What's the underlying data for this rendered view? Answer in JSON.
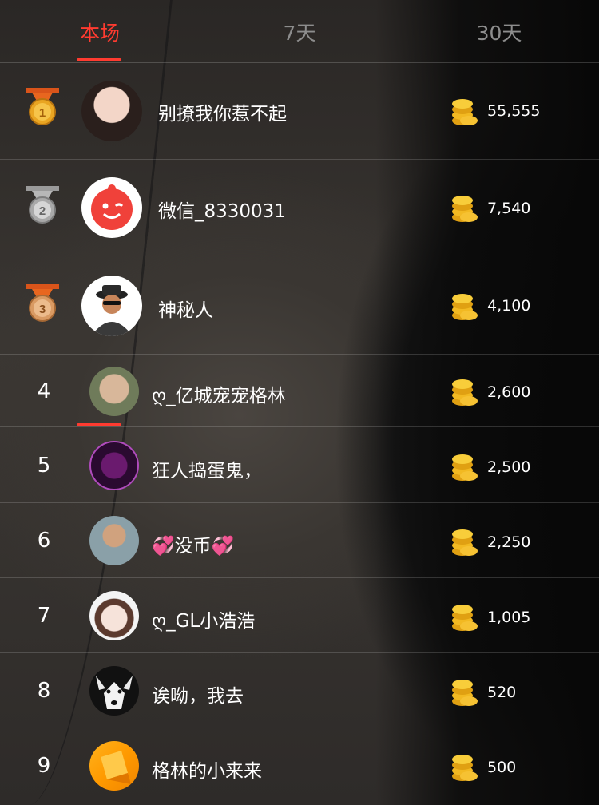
{
  "tabs": [
    {
      "label": "本场",
      "active": true
    },
    {
      "label": "7天",
      "active": false
    },
    {
      "label": "30天",
      "active": false
    }
  ],
  "accent_color": "#ff3b30",
  "coin_icon": "gold-coins-icon",
  "rows": [
    {
      "rank": "1",
      "medal": "gold",
      "name": "别撩我你惹不起",
      "amount": "55,555",
      "avatar": "woman-portrait"
    },
    {
      "rank": "2",
      "medal": "silver",
      "name": "微信_8330031",
      "amount": "7,540",
      "avatar": "red-face-logo"
    },
    {
      "rank": "3",
      "medal": "bronze",
      "name": "神秘人",
      "amount": "4,100",
      "avatar": "hat-sunglasses-man"
    },
    {
      "rank": "4",
      "name": "ღ_亿城宠宠格林",
      "amount": "2,600",
      "avatar": "person-photo"
    },
    {
      "rank": "5",
      "name": "狂人捣蛋鬼，",
      "amount": "2,500",
      "avatar": "neon-logo"
    },
    {
      "rank": "6",
      "name": "💞没币💞",
      "amount": "2,250",
      "avatar": "man-with-child"
    },
    {
      "rank": "7",
      "name": "ღ_GL小浩浩",
      "amount": "1,005",
      "avatar": "cartoon-girl"
    },
    {
      "rank": "8",
      "name": "诶呦，我去",
      "amount": "520",
      "avatar": "husky-dog"
    },
    {
      "rank": "9",
      "name": "格林的小来来",
      "amount": "500",
      "avatar": "orange-shapes"
    }
  ]
}
